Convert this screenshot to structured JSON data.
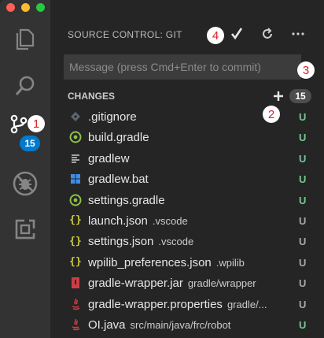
{
  "window": {
    "traffic_lights": [
      "close",
      "minimize",
      "zoom"
    ]
  },
  "activity_bar": {
    "items": [
      {
        "name": "explorer",
        "icon": "files-icon"
      },
      {
        "name": "search",
        "icon": "search-icon"
      },
      {
        "name": "source-control",
        "icon": "git-branch-icon",
        "badge": "15"
      },
      {
        "name": "debug",
        "icon": "no-bug-icon"
      },
      {
        "name": "extensions",
        "icon": "extensions-icon"
      }
    ]
  },
  "source_control": {
    "title": "SOURCE CONTROL: GIT",
    "commit_icon": "checkmark-icon",
    "refresh_icon": "refresh-icon",
    "more_icon": "ellipsis-icon",
    "message_placeholder": "Message (press Cmd+Enter to commit)",
    "changes_label": "CHANGES",
    "changes_count": "15",
    "stage_all_icon": "plus-icon"
  },
  "files": [
    {
      "name": ".gitignore",
      "dir": "",
      "status": "U",
      "icon": "git-icon",
      "status_color": "#73c991"
    },
    {
      "name": "build.gradle",
      "dir": "",
      "status": "U",
      "icon": "gradle-icon",
      "status_color": "#73c991"
    },
    {
      "name": "gradlew",
      "dir": "",
      "status": "U",
      "icon": "text-file-icon",
      "status_color": "#73c991"
    },
    {
      "name": "gradlew.bat",
      "dir": "",
      "status": "U",
      "icon": "windows-icon",
      "status_color": "#73c991"
    },
    {
      "name": "settings.gradle",
      "dir": "",
      "status": "U",
      "icon": "gradle-icon",
      "status_color": "#73c991"
    },
    {
      "name": "launch.json",
      "dir": ".vscode",
      "status": "U",
      "icon": "json-icon",
      "status_color": "#a8a8a8"
    },
    {
      "name": "settings.json",
      "dir": ".vscode",
      "status": "U",
      "icon": "json-icon",
      "status_color": "#a8a8a8"
    },
    {
      "name": "wpilib_preferences.json",
      "dir": ".wpilib",
      "status": "U",
      "icon": "json-icon",
      "status_color": "#a8a8a8"
    },
    {
      "name": "gradle-wrapper.jar",
      "dir": "gradle/wrapper",
      "status": "U",
      "icon": "jar-icon",
      "status_color": "#a8a8a8"
    },
    {
      "name": "gradle-wrapper.properties",
      "dir": "gradle/...",
      "status": "U",
      "icon": "java-icon",
      "status_color": "#a8a8a8"
    },
    {
      "name": "OI.java",
      "dir": "src/main/java/frc/robot",
      "status": "U",
      "icon": "java-icon",
      "status_color": "#73c991"
    }
  ],
  "callouts": [
    "1",
    "2",
    "3",
    "4"
  ],
  "colors": {
    "activity_bar": "#333333",
    "sidebar": "#252526",
    "accent_badge": "#007acc",
    "untracked_green": "#73c991",
    "callout_red": "#d9232a"
  }
}
